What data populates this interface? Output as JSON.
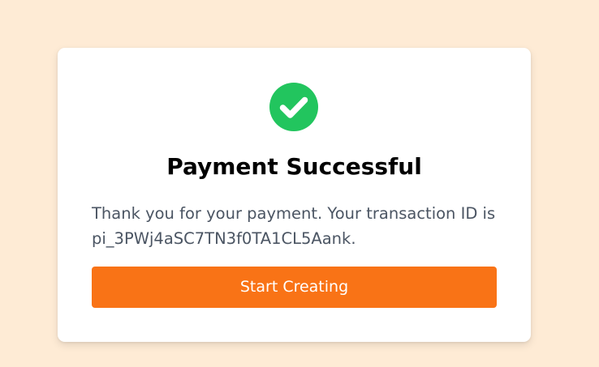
{
  "icon": "check-circle-icon",
  "colors": {
    "page_background": "#feebd5",
    "card_background": "#ffffff",
    "success": "#22c55e",
    "button": "#f97316",
    "body_text": "#4b5563"
  },
  "dialog": {
    "title": "Payment Successful",
    "message_lines": [
      "Thank you for your payment. Your transaction ID is",
      "pi_3PWj4aSC7TN3f0TA1CL5Aank."
    ],
    "button_label": "Start Creating"
  }
}
